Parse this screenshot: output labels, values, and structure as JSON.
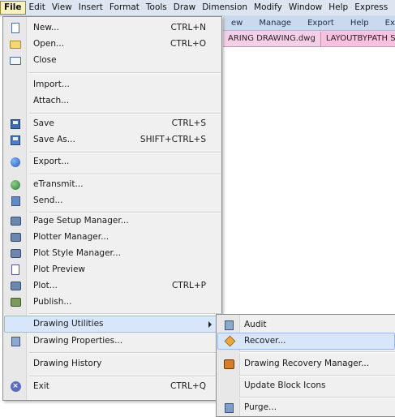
{
  "menubar": {
    "items": [
      "File",
      "Edit",
      "View",
      "Insert",
      "Format",
      "Tools",
      "Draw",
      "Dimension",
      "Modify",
      "Window",
      "Help",
      "Express"
    ]
  },
  "ribbon": {
    "tabs": [
      "ew",
      "Manage",
      "Export",
      "Help",
      "Ex"
    ]
  },
  "file_tabs": {
    "tabs": [
      "ARING DRAWING.dwg",
      "LAYOUTBYPATH SAMP"
    ]
  },
  "file_menu": {
    "items": [
      {
        "label": "New...",
        "shortcut": "CTRL+N",
        "icon": "new-document-icon"
      },
      {
        "label": "Open...",
        "shortcut": "CTRL+O",
        "icon": "open-folder-icon"
      },
      {
        "label": "Close",
        "shortcut": "",
        "icon": "close-folder-icon"
      },
      {
        "label": "Import...",
        "shortcut": "",
        "icon": ""
      },
      {
        "label": "Attach...",
        "shortcut": "",
        "icon": ""
      },
      {
        "label": "Save",
        "shortcut": "CTRL+S",
        "icon": "save-icon"
      },
      {
        "label": "Save As...",
        "shortcut": "SHIFT+CTRL+S",
        "icon": "save-as-icon"
      },
      {
        "label": "Export...",
        "shortcut": "",
        "icon": "export-icon"
      },
      {
        "label": "eTransmit...",
        "shortcut": "",
        "icon": "etransmit-icon"
      },
      {
        "label": "Send...",
        "shortcut": "",
        "icon": "send-icon"
      },
      {
        "label": "Page Setup Manager...",
        "shortcut": "",
        "icon": "page-setup-icon"
      },
      {
        "label": "Plotter Manager...",
        "shortcut": "",
        "icon": "plotter-manager-icon"
      },
      {
        "label": "Plot Style Manager...",
        "shortcut": "",
        "icon": "plot-style-icon"
      },
      {
        "label": "Plot Preview",
        "shortcut": "",
        "icon": "plot-preview-icon"
      },
      {
        "label": "Plot...",
        "shortcut": "CTRL+P",
        "icon": "plot-icon"
      },
      {
        "label": "Publish...",
        "shortcut": "",
        "icon": "publish-icon"
      },
      {
        "label": "Drawing Utilities",
        "shortcut": "",
        "icon": ""
      },
      {
        "label": "Drawing Properties...",
        "shortcut": "",
        "icon": "drawing-properties-icon"
      },
      {
        "label": "Drawing History",
        "shortcut": "",
        "icon": ""
      },
      {
        "label": "Exit",
        "shortcut": "CTRL+Q",
        "icon": "exit-icon"
      }
    ]
  },
  "submenu": {
    "items": [
      {
        "label": "Audit",
        "icon": "audit-icon"
      },
      {
        "label": "Recover...",
        "icon": "recover-icon"
      },
      {
        "label": "Drawing Recovery Manager...",
        "icon": "recovery-manager-icon"
      },
      {
        "label": "Update Block Icons",
        "icon": ""
      },
      {
        "label": "Purge...",
        "icon": "purge-icon"
      }
    ]
  },
  "colors": {
    "menubar_bg": "#dde5f0",
    "menu_bg": "#f0f0f0",
    "highlight_bg": "#d7e6fb",
    "file_tab_bg": "#f3d0e6"
  }
}
